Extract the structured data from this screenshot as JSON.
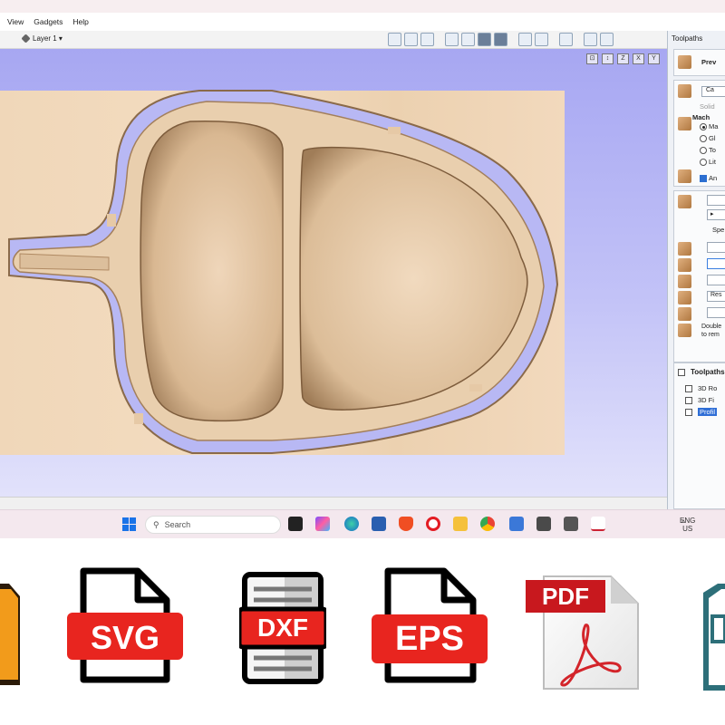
{
  "menu": {
    "items": [
      "View",
      "Gadgets",
      "Help"
    ]
  },
  "toolbar": {
    "layer_label": "Layer 1 ▾"
  },
  "viewport": {
    "axis_buttons": [
      "⊡",
      "↕",
      "Z",
      "X",
      "Y"
    ]
  },
  "panel": {
    "tab_label": "Toolpaths",
    "preview_label": "Prev",
    "material_btn": "Ca",
    "solid_label": "Solid",
    "machine_label": "Mach",
    "options": [
      "Ma",
      "Gl",
      "To",
      "Lit"
    ],
    "anim_label": "An",
    "speed_label": "Spe",
    "reset_label": "Res",
    "hint_line1": "Double",
    "hint_line2": "to rem",
    "toolpaths_header": "Toolpaths",
    "toolpath_items": [
      "3D Ro",
      "3D Fi",
      "Profil"
    ]
  },
  "taskbar": {
    "search_placeholder": "Search",
    "lang": "ENG",
    "region": "US"
  },
  "formats": {
    "labels": [
      "SVG",
      "DXF",
      "EPS",
      "PDF"
    ]
  },
  "colors": {
    "viewport_top": "#a7a7f2",
    "wood": "#f0d7b9",
    "accent_red": "#e8251f",
    "selection": "#2f6ed6"
  }
}
